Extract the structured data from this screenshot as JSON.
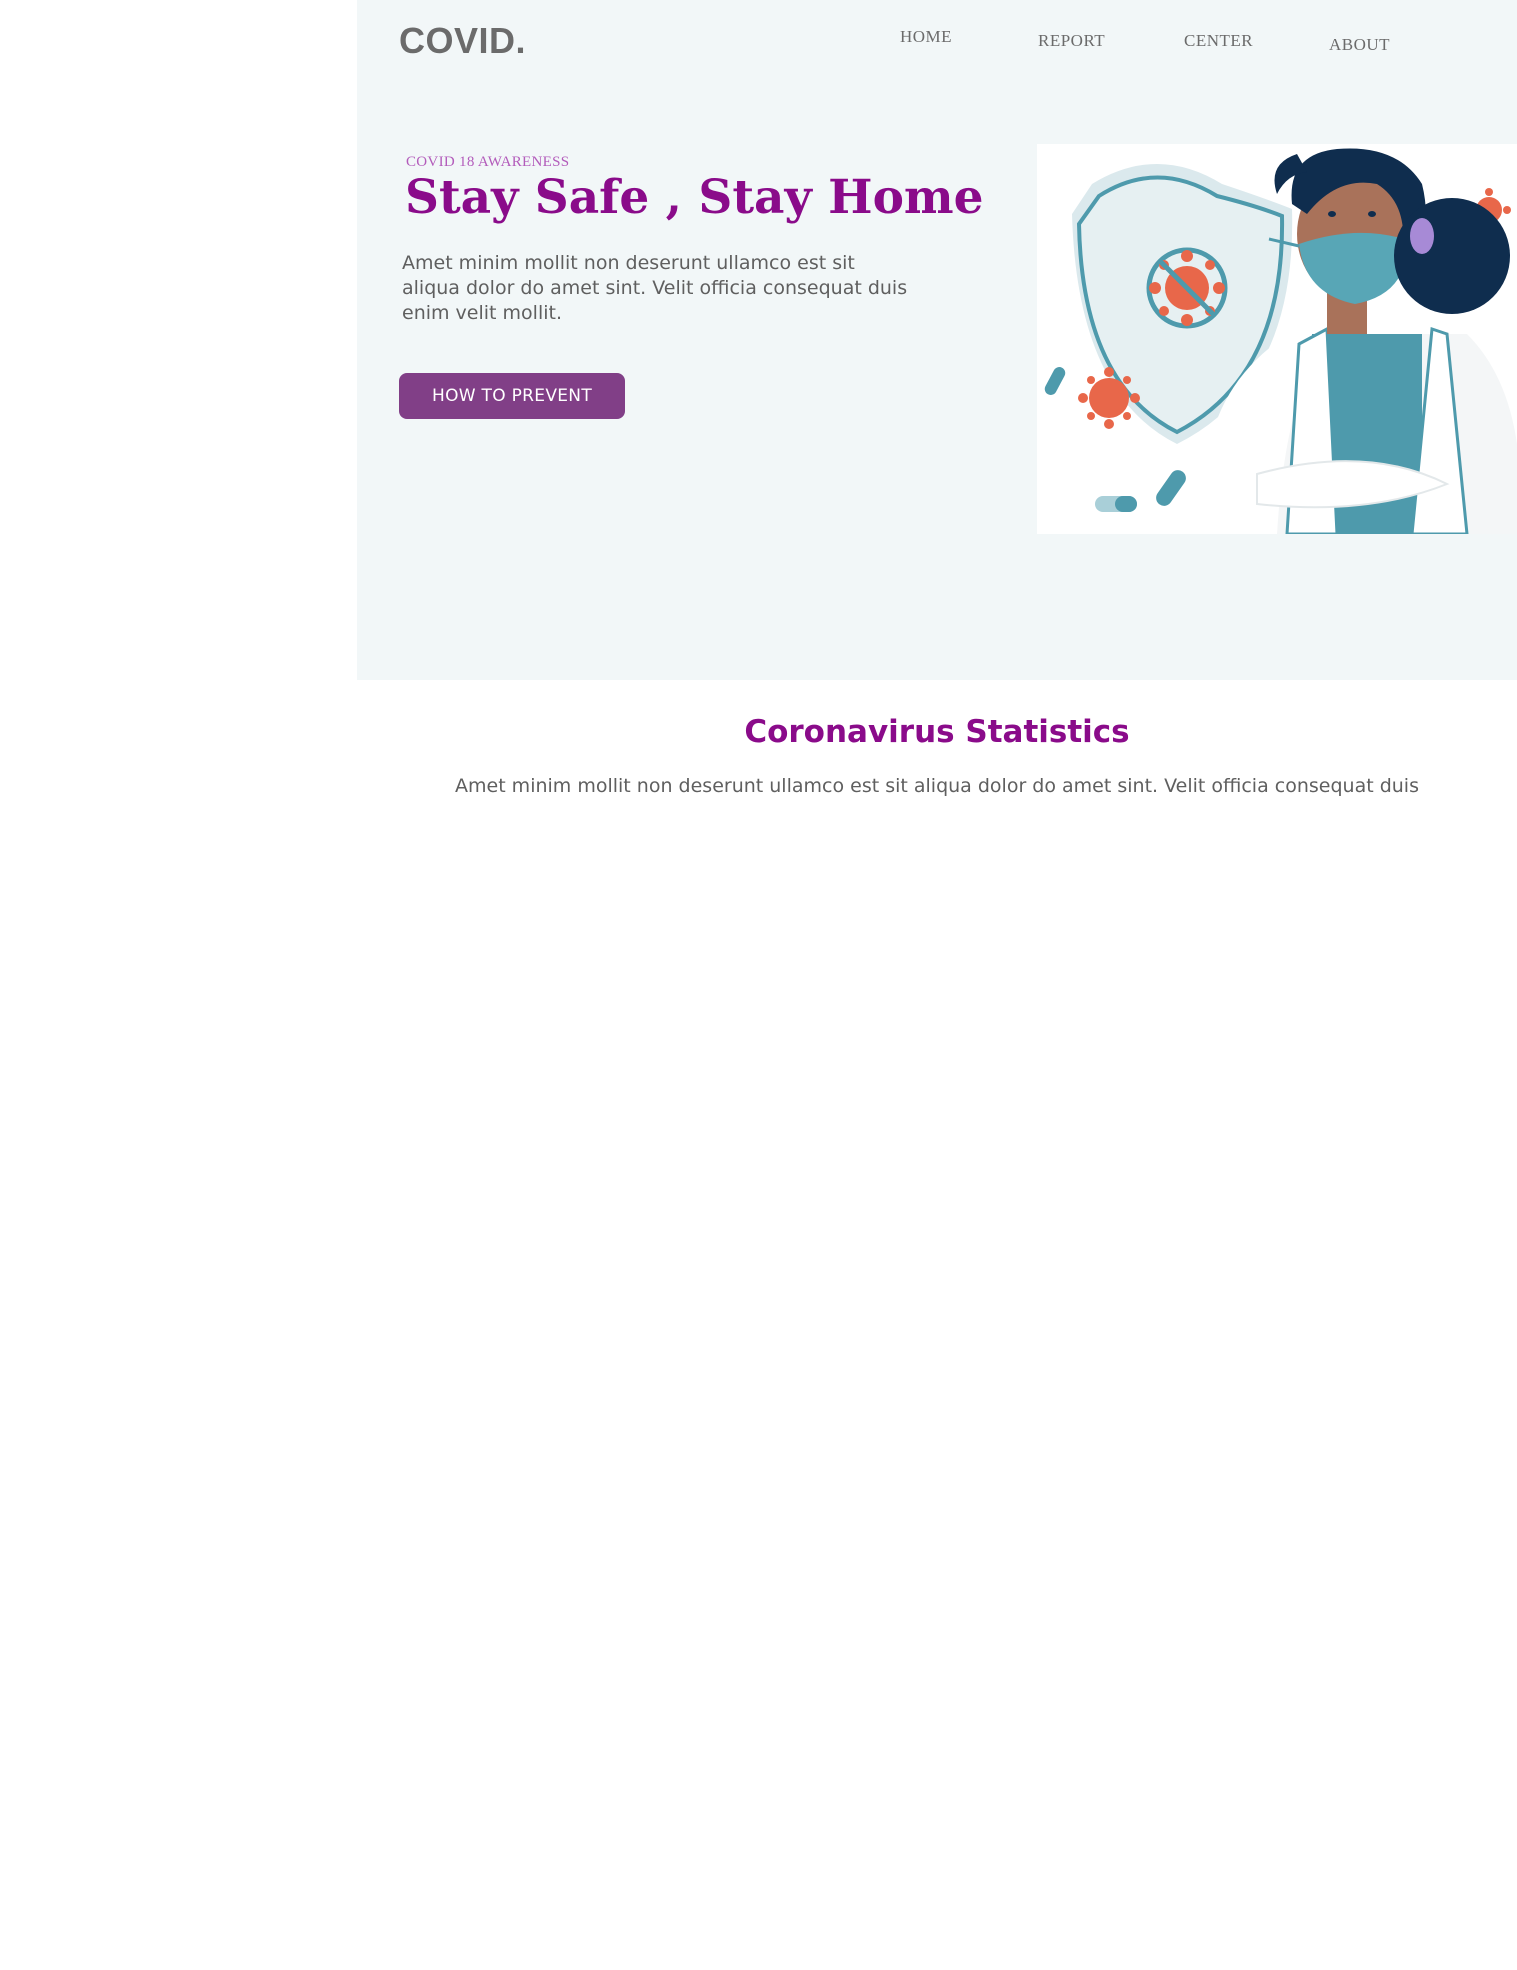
{
  "header": {
    "logo": "COVID.",
    "nav": [
      {
        "label": "HOME"
      },
      {
        "label": "REPORT"
      },
      {
        "label": "CENTER"
      },
      {
        "label": "ABOUT"
      }
    ]
  },
  "hero": {
    "kicker": "COVID 18 AWARENESS",
    "headline": "Stay Safe , Stay Home",
    "body": "Amet minim mollit non deserunt ullamco est sit aliqua dolor do amet sint. Velit officia consequat duis enim velit mollit.",
    "cta_label": "HOW TO PREVENT",
    "illustration": "woman-in-mask-with-shield-illustration"
  },
  "stats": {
    "title": "Coronavirus Statistics",
    "body": "Amet minim mollit non deserunt ullamco est sit aliqua dolor do amet sint. Velit officia consequat duis"
  },
  "colors": {
    "hero_bg": "#f2f7f8",
    "accent_purple": "#8a0b8a",
    "button_purple": "#813f87",
    "kicker_purple": "#b35cbb",
    "text_gray": "#5f5f5f",
    "teal": "#4e9aac",
    "virus_orange": "#e8674a",
    "hair_navy": "#0f2d4e"
  }
}
